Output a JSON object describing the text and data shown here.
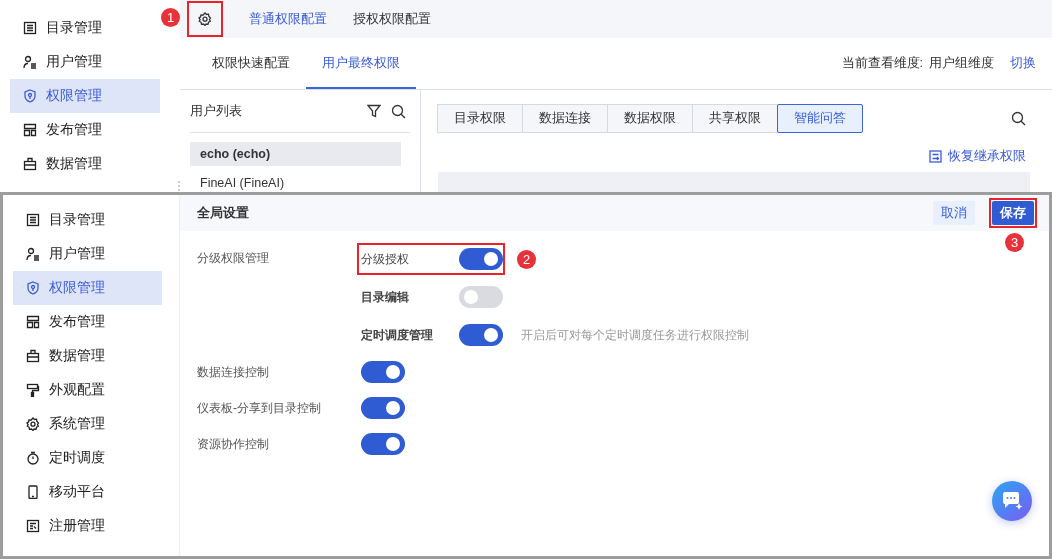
{
  "top_panel": {
    "sidebar": [
      {
        "label": "目录管理",
        "selected": false
      },
      {
        "label": "用户管理",
        "selected": false
      },
      {
        "label": "权限管理",
        "selected": true
      },
      {
        "label": "发布管理",
        "selected": false
      },
      {
        "label": "数据管理",
        "selected": false
      }
    ],
    "marker": "1",
    "top_tabs": [
      {
        "label": "普通权限配置",
        "selected": true
      },
      {
        "label": "授权权限配置",
        "selected": false
      }
    ],
    "sub_tabs": [
      {
        "label": "权限快速配置",
        "selected": false
      },
      {
        "label": "用户最终权限",
        "selected": true
      }
    ],
    "dimension_label": "当前查看维度:",
    "dimension_value": "用户组维度",
    "switch_link": "切换",
    "user_list": {
      "title": "用户列表",
      "users": [
        {
          "name": "echo (echo)",
          "selected": true
        },
        {
          "name": "FineAI (FineAI)",
          "selected": false
        }
      ]
    },
    "permission_tabs": [
      {
        "label": "目录权限",
        "selected": false
      },
      {
        "label": "数据连接",
        "selected": false
      },
      {
        "label": "数据权限",
        "selected": false
      },
      {
        "label": "共享权限",
        "selected": false
      },
      {
        "label": "智能问答",
        "selected": true
      }
    ],
    "restore_link": "恢复继承权限"
  },
  "bottom_panel": {
    "sidebar": [
      {
        "label": "目录管理",
        "selected": false
      },
      {
        "label": "用户管理",
        "selected": false
      },
      {
        "label": "权限管理",
        "selected": true
      },
      {
        "label": "发布管理",
        "selected": false
      },
      {
        "label": "数据管理",
        "selected": false
      },
      {
        "label": "外观配置",
        "selected": false
      },
      {
        "label": "系统管理",
        "selected": false
      },
      {
        "label": "定时调度",
        "selected": false
      },
      {
        "label": "移动平台",
        "selected": false
      },
      {
        "label": "注册管理",
        "selected": false
      }
    ],
    "title": "全局设置",
    "buttons": [
      {
        "label": "取消",
        "kind": "secondary"
      },
      {
        "label": "保存",
        "kind": "primary",
        "marker": "3"
      }
    ],
    "settings": [
      {
        "kind": "group",
        "label": "分级权限管理",
        "children": [
          {
            "label": "分级授权",
            "on": true,
            "marker": "2"
          },
          {
            "label": "目录编辑",
            "on": false
          },
          {
            "label": "定时调度管理",
            "on": true,
            "hint": "开启后可对每个定时调度任务进行权限控制"
          }
        ]
      },
      {
        "kind": "switch",
        "label": "数据连接控制",
        "on": true
      },
      {
        "kind": "switch",
        "label": "仪表板-分享到目录控制",
        "on": true
      },
      {
        "kind": "switch",
        "label": "资源协作控制",
        "on": true
      }
    ]
  }
}
